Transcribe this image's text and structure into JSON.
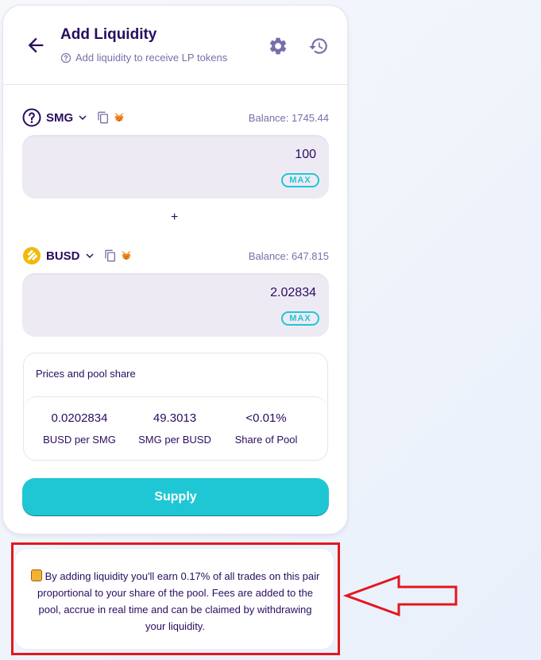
{
  "header": {
    "title": "Add Liquidity",
    "subtitle": "Add liquidity to receive LP tokens"
  },
  "token_a": {
    "symbol": "SMG",
    "balance": "Balance: 1745.44",
    "amount": "100",
    "max_label": "MAX"
  },
  "plus_sign": "+",
  "token_b": {
    "symbol": "BUSD",
    "balance": "Balance: 647.815",
    "amount": "2.02834",
    "max_label": "MAX"
  },
  "pool": {
    "title": "Prices and pool share",
    "stats": [
      {
        "value": "0.0202834",
        "label": "BUSD per SMG"
      },
      {
        "value": "49.3013",
        "label": "SMG per BUSD"
      },
      {
        "value": "<0.01%",
        "label": "Share of Pool"
      }
    ]
  },
  "supply_label": "Supply",
  "info": {
    "text": "By adding liquidity you'll earn 0.17% of all trades on this pair proportional to your share of the pool. Fees are added to the pool, accrue in real time and can be claimed by withdrawing your liquidity."
  },
  "colors": {
    "primary": "#1fc7d4",
    "text": "#280d5f",
    "secondary_text": "#7a6eaa",
    "input_bg": "#eeeaf4",
    "annotation": "#e3171e"
  }
}
